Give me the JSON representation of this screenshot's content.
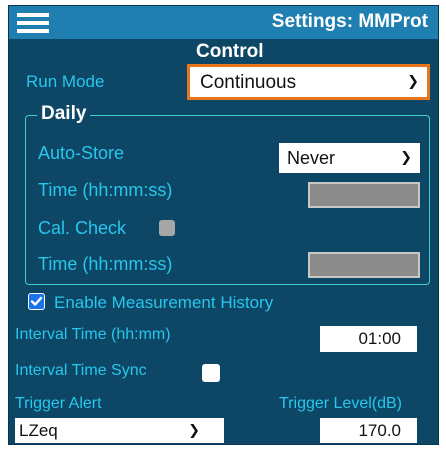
{
  "header": {
    "title": "Settings: MMProt",
    "menu_icon": "hamburger-menu-icon"
  },
  "control": {
    "section_title": "Control",
    "run_mode_label": "Run Mode",
    "run_mode_value": "Continuous"
  },
  "daily": {
    "legend": "Daily",
    "auto_store_label": "Auto-Store",
    "auto_store_value": "Never",
    "time_label_1": "Time (hh:mm:ss)",
    "cal_check_label": "Cal. Check",
    "time_label_2": "Time (hh:mm:ss)"
  },
  "history": {
    "enable_label": "Enable Measurement History",
    "enable_checked": true,
    "interval_time_label": "Interval Time (hh:mm)",
    "interval_time_value": "01:00",
    "interval_sync_label": "Interval Time Sync"
  },
  "trigger": {
    "alert_label": "Trigger Alert",
    "alert_value": "LZeq",
    "level_label": "Trigger Level(dB)",
    "level_value": "170.0"
  },
  "colors": {
    "panel_bg": "#0e4766",
    "titlebar_bg": "#1e7fb0",
    "label_cyan": "#27c6ec",
    "accent_orange": "#e8741c",
    "daily_border": "#3fd0c8"
  }
}
